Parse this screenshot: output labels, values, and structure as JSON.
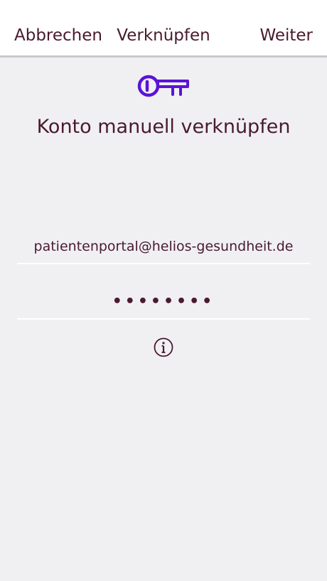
{
  "navbar": {
    "cancel_label": "Abbrechen",
    "title": "Verknüpfen",
    "next_label": "Weiter"
  },
  "main": {
    "icon": "key-icon",
    "heading": "Konto manuell verknüpfen",
    "email_value": "patientenportal@helios-gesundheit.de",
    "password_value": "••••••••",
    "info_icon": "info-icon"
  },
  "colors": {
    "accent": "#5a14d6",
    "text": "#4a1a2e",
    "background": "#f0f0f3",
    "navbar_bg": "#ffffff"
  }
}
